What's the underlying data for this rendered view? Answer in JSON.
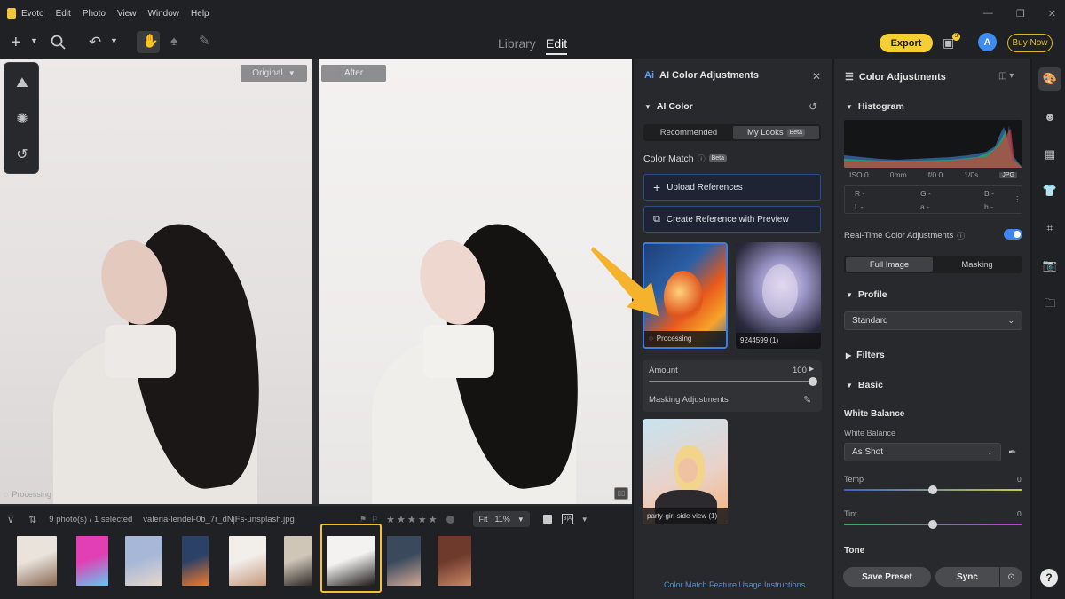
{
  "app": {
    "name": "Evoto"
  },
  "menu": [
    "Edit",
    "Photo",
    "View",
    "Window",
    "Help"
  ],
  "toolbar": {
    "tabs": [
      {
        "label": "Library",
        "active": false
      },
      {
        "label": "Edit",
        "active": true
      }
    ],
    "export_label": "Export",
    "gift_badge": "3",
    "avatar_initial": "A",
    "buy_now_label": "Buy Now"
  },
  "canvas": {
    "original_label": "Original",
    "after_label": "After",
    "processing_label": "Processing"
  },
  "filmstrip": {
    "photo_count": "9 photo(s) / 1 selected",
    "filename": "valeria-lendel-0b_7r_dNjFs-unsplash.jpg",
    "rating_stars": 5,
    "fit_label": "Fit",
    "zoom": "11%",
    "selected_index": 6,
    "thumb_colors": [
      [
        "#e9e3dc",
        "#8a6a54"
      ],
      [
        "#e23fb4",
        "#61c9f2"
      ],
      [
        "#a6b7d8",
        "#e6d7cc"
      ],
      [
        "#2c4168",
        "#f07a2a"
      ],
      [
        "#f2eeea",
        "#c7987d"
      ],
      [
        "#cfc6b8",
        "#2f2a26"
      ],
      [
        "#f4f2f1",
        "#1c1818"
      ],
      [
        "#3a4a5c",
        "#d1a897"
      ],
      [
        "#6e3a2c",
        "#c98766"
      ]
    ]
  },
  "ai_panel": {
    "title": "AI Color Adjustments",
    "ai_color_label": "AI Color",
    "segments": [
      {
        "label": "Recommended",
        "active": false
      },
      {
        "label": "My Looks",
        "active": true
      }
    ],
    "my_looks_badge": "Beta",
    "color_match_label": "Color Match",
    "color_match_badge": "Beta",
    "upload_label": "Upload References",
    "create_ref_label": "Create Reference with Preview",
    "ref1_caption": "Processing",
    "ref2_caption": "9244599 (1)",
    "amount_label": "Amount",
    "amount_value": "100",
    "amount_fraction": 1.0,
    "masking_label": "Masking Adjustments",
    "party_caption": "party-girl-side-view (1)",
    "usage_link": "Color Match Feature Usage Instructions"
  },
  "color_panel": {
    "title": "Color Adjustments",
    "histogram_label": "Histogram",
    "exif": [
      "ISO 0",
      "0mm",
      "f/0.0",
      "1/0s",
      "JPG"
    ],
    "rgb": [
      [
        "R",
        "-"
      ],
      [
        "G",
        "-"
      ],
      [
        "B",
        "-"
      ]
    ],
    "lab": [
      [
        "L",
        "-"
      ],
      [
        "a",
        "-"
      ],
      [
        "b",
        "-"
      ]
    ],
    "realtime_label": "Real-Time Color Adjustments",
    "realtime_on": true,
    "mask_segments": [
      {
        "label": "Full Image",
        "active": true
      },
      {
        "label": "Masking",
        "active": false
      }
    ],
    "profile_label": "Profile",
    "profile_value": "Standard",
    "filters_label": "Filters",
    "basic_label": "Basic",
    "white_balance_heading": "White Balance",
    "white_balance_sub": "White Balance",
    "white_balance_value": "As Shot",
    "temp_label": "Temp",
    "temp_value": "0",
    "tint_label": "Tint",
    "tint_value": "0",
    "tone_label": "Tone",
    "save_preset_label": "Save Preset",
    "sync_label": "Sync"
  },
  "colors": {
    "accent_yellow": "#f5cf32",
    "accent_blue": "#3f86ee",
    "panel_bg": "#28292c"
  }
}
